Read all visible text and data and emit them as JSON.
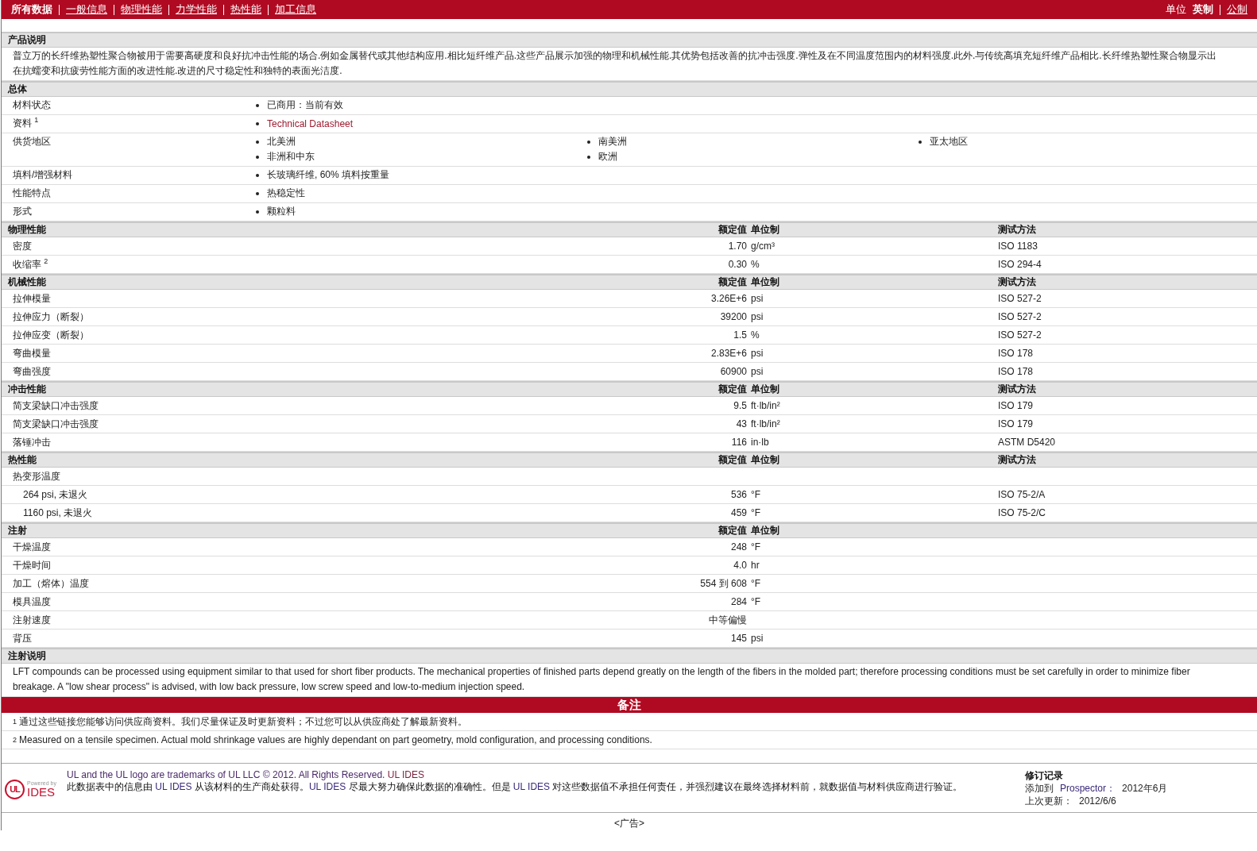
{
  "nav": {
    "tabs": [
      {
        "label": "所有数据",
        "selected": true
      },
      {
        "label": "一般信息",
        "selected": false
      },
      {
        "label": "物理性能",
        "selected": false
      },
      {
        "label": "力学性能",
        "selected": false
      },
      {
        "label": "热性能",
        "selected": false
      },
      {
        "label": "加工信息",
        "selected": false
      }
    ],
    "units_label": "单位",
    "units": [
      {
        "label": "英制",
        "selected": true
      },
      {
        "label": "公制",
        "selected": false
      }
    ]
  },
  "description": {
    "title": "产品说明",
    "text": "普立万的长纤维热塑性聚合物被用于需要高硬度和良好抗冲击性能的场合.例如金属替代或其他结构应用.相比短纤维产品.这些产品展示加强的物理和机械性能.其优势包括改善的抗冲击强度.弹性及在不同温度范围内的材料强度.此外.与传统高填充短纤维产品相比.长纤维热塑性聚合物显示出在抗蠕变和抗疲劳性能方面的改进性能.改进的尺寸稳定性和独特的表面光洁度."
  },
  "general": {
    "title": "总体",
    "rows": [
      {
        "label": "材料状态",
        "kind": "list",
        "items": [
          "已商用：当前有效"
        ]
      },
      {
        "label": "资料 $^{1}$",
        "kind": "links",
        "items": [
          "Technical Datasheet"
        ]
      },
      {
        "label": "供货地区",
        "kind": "list",
        "items": [
          "北美洲",
          "南美洲",
          "亚太地区",
          "非洲和中东",
          "欧洲"
        ]
      },
      {
        "label": "填料/增强材料",
        "kind": "list",
        "items": [
          "长玻璃纤维, 60% 填料按重量"
        ]
      },
      {
        "label": "性能特点",
        "kind": "list",
        "items": [
          "热稳定性"
        ]
      },
      {
        "label": "形式",
        "kind": "list",
        "items": [
          "颗粒料"
        ]
      }
    ]
  },
  "property_sections": [
    {
      "title": "物理性能",
      "headers": {
        "value": "额定值",
        "unit": "单位制",
        "method": "测试方法"
      },
      "rows": [
        {
          "label": "密度",
          "value": "1.70",
          "unit": "g/cm³",
          "method": "ISO 1183"
        },
        {
          "label": "收缩率 $^{2}$",
          "value": "0.30",
          "unit": "%",
          "method": "ISO 294-4"
        }
      ]
    },
    {
      "title": "机械性能",
      "headers": {
        "value": "额定值",
        "unit": "单位制",
        "method": "测试方法"
      },
      "rows": [
        {
          "label": "拉伸模量",
          "value": "3.26E+6",
          "unit": "psi",
          "method": "ISO 527-2"
        },
        {
          "label": "拉伸应力（断裂）",
          "value": "39200",
          "unit": "psi",
          "method": "ISO 527-2"
        },
        {
          "label": "拉伸应变（断裂）",
          "value": "1.5",
          "unit": "%",
          "method": "ISO 527-2"
        },
        {
          "label": "弯曲模量",
          "value": "2.83E+6",
          "unit": "psi",
          "method": "ISO 178"
        },
        {
          "label": "弯曲强度",
          "value": "60900",
          "unit": "psi",
          "method": "ISO 178"
        }
      ]
    },
    {
      "title": "冲击性能",
      "headers": {
        "value": "额定值",
        "unit": "单位制",
        "method": "测试方法"
      },
      "rows": [
        {
          "label": "简支梁缺口冲击强度",
          "value": "9.5",
          "unit": "ft·lb/in²",
          "method": "ISO 179"
        },
        {
          "label": "简支梁缺口冲击强度",
          "value": "43",
          "unit": "ft·lb/in²",
          "method": "ISO 179"
        },
        {
          "label": "落锤冲击",
          "value": "116",
          "unit": "in·lb",
          "method": "ASTM D5420"
        }
      ]
    },
    {
      "title": "热性能",
      "headers": {
        "value": "额定值",
        "unit": "单位制",
        "method": "测试方法"
      },
      "rows": [
        {
          "label": "热变形温度",
          "children": [
            {
              "label": "264 psi, 未退火",
              "value": "536",
              "unit": "°F",
              "method": "ISO 75-2/A"
            },
            {
              "label": "1160 psi, 未退火",
              "value": "459",
              "unit": "°F",
              "method": "ISO 75-2/C"
            }
          ]
        }
      ]
    },
    {
      "title": "注射",
      "headers": {
        "value": "额定值",
        "unit": "单位制"
      },
      "rows": [
        {
          "label": "干燥温度",
          "value": "248",
          "unit": "°F"
        },
        {
          "label": "干燥时间",
          "value": "4.0",
          "unit": "hr"
        },
        {
          "label": "加工（熔体）温度",
          "value": "554 到  608",
          "unit": "°F"
        },
        {
          "label": "模具温度",
          "value": "284",
          "unit": "°F"
        },
        {
          "label": "注射速度",
          "value": "中等偏慢"
        },
        {
          "label": "背压",
          "value": "145",
          "unit": "psi"
        }
      ]
    }
  ],
  "processing_notes": {
    "title": "注射说明",
    "text": "LFT compounds can be processed using equipment similar to that used for short fiber products. The mechanical properties of finished parts depend greatly on the length of the fibers in the molded part; therefore processing conditions must be set carefully in order to minimize fiber breakage. A \"low shear process\" is advised, with low back pressure, low screw speed and low-to-medium injection speed."
  },
  "remarks": {
    "title": "备注",
    "notes": [
      "$^{1}$ 通过这些链接您能够访问供应商资料。我们尽量保证及时更新资料；不过您可以从供应商处了解最新资料。",
      "$^{2}$ Measured on a tensile specimen. Actual mold shrinkage values are highly dependant on part geometry, mold configuration, and processing conditions."
    ]
  },
  "footer": {
    "logo": {
      "mark": "UL",
      "caption": "Powered by",
      "name": "IDES"
    },
    "copyright": "UL and the UL logo are trademarks of UL LLC © 2012. All Rights Reserved.",
    "copyright_link": "UL IDES",
    "disclaimer": [
      {
        "text": "此数据表中的信息由 ",
        "kind": "plain"
      },
      {
        "text": "UL IDES",
        "kind": "brand"
      },
      {
        "text": " 从该材料的生产商处获得。",
        "kind": "plain"
      },
      {
        "text": "UL IDES",
        "kind": "brand"
      },
      {
        "text": " 尽最大努力确保此数据的准确性。但是 ",
        "kind": "plain"
      },
      {
        "text": "UL IDES",
        "kind": "brand"
      },
      {
        "text": " 对这些数据值不承担任何责任，并强烈建议在最终选择材料前，就数据值与材料供应商进行验证。",
        "kind": "plain"
      }
    ],
    "revision": {
      "title": "修订记录",
      "entries": [
        {
          "label": "添加到",
          "source": "Prospector：",
          "date": "2012年6月"
        },
        {
          "label": "上次更新：",
          "date": "2012/6/6"
        }
      ]
    }
  },
  "ad": "<广告>"
}
